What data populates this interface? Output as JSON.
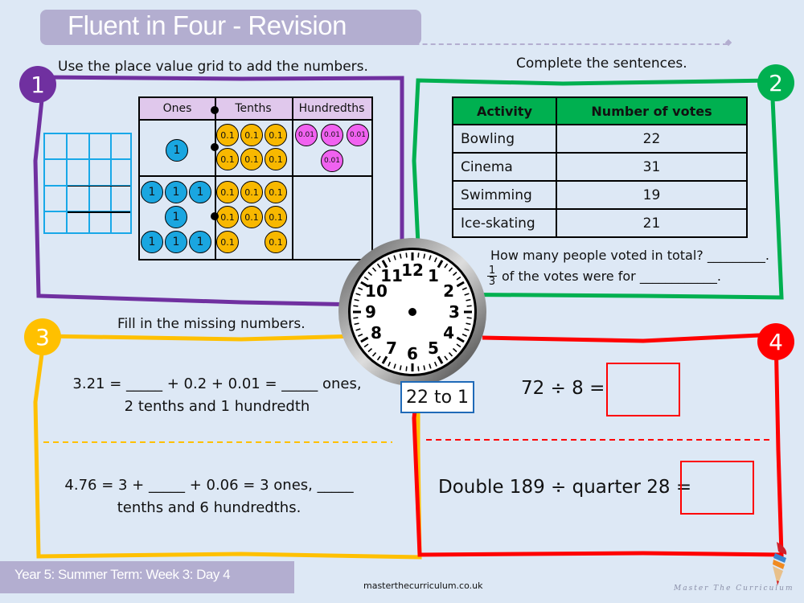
{
  "header": {
    "title": "Fluent in Four - Revision"
  },
  "q1": {
    "number": "1",
    "instruction": "Use the place value grid to add the numbers.",
    "columns": [
      "Ones",
      "Tenths",
      "Hundredths"
    ],
    "row1": {
      "ones": [
        "1"
      ],
      "tenths": [
        "0.1",
        "0.1",
        "0.1",
        "0.1",
        "0.1",
        "0.1"
      ],
      "hundredths": [
        "0.01",
        "0.01",
        "0.01",
        "0.01"
      ]
    },
    "row2": {
      "ones": [
        "1",
        "1",
        "1",
        "1",
        "1",
        "1",
        "1"
      ],
      "tenths": [
        "0.1",
        "0.1",
        "0.1",
        "0.1",
        "0.1",
        "0.1",
        "0.1",
        "0.1"
      ],
      "hundredths": []
    },
    "color": "#7030a0"
  },
  "q2": {
    "number": "2",
    "instruction": "Complete the sentences.",
    "table_headers": [
      "Activity",
      "Number of votes"
    ],
    "rows": [
      {
        "activity": "Bowling",
        "votes": "22"
      },
      {
        "activity": "Cinema",
        "votes": "31"
      },
      {
        "activity": "Swimming",
        "votes": "19"
      },
      {
        "activity": "Ice-skating",
        "votes": "21"
      }
    ],
    "question1": "How many people voted in total? _________.",
    "fraction_num": "1",
    "fraction_den": "3",
    "question2": "of the votes were for ____________.",
    "color": "#00b050"
  },
  "q3": {
    "number": "3",
    "instruction": "Fill in the missing numbers.",
    "eq1_line1": "3.21 = _____ + 0.2 + 0.01 = _____ ones,",
    "eq1_line2": "2 tenths and 1 hundredth",
    "eq2_line1": "4.76 = 3 + _____  + 0.06 =  3 ones, _____",
    "eq2_line2": "tenths and 6 hundredths.",
    "color": "#ffc000"
  },
  "q4": {
    "number": "4",
    "eq1": "72 ÷ 8 =",
    "eq2": "Double 189 ÷ quarter 28 =",
    "color": "#ff0000"
  },
  "clock": {
    "numbers": [
      "12",
      "1",
      "2",
      "3",
      "4",
      "5",
      "6",
      "7",
      "8",
      "9",
      "10",
      "11"
    ],
    "time_label": "22 to 1"
  },
  "footer": {
    "lesson": "Year 5: Summer Term: Week 3: Day 4",
    "url": "masterthecurriculum.co.uk",
    "brand": "Master The Curriculum"
  }
}
